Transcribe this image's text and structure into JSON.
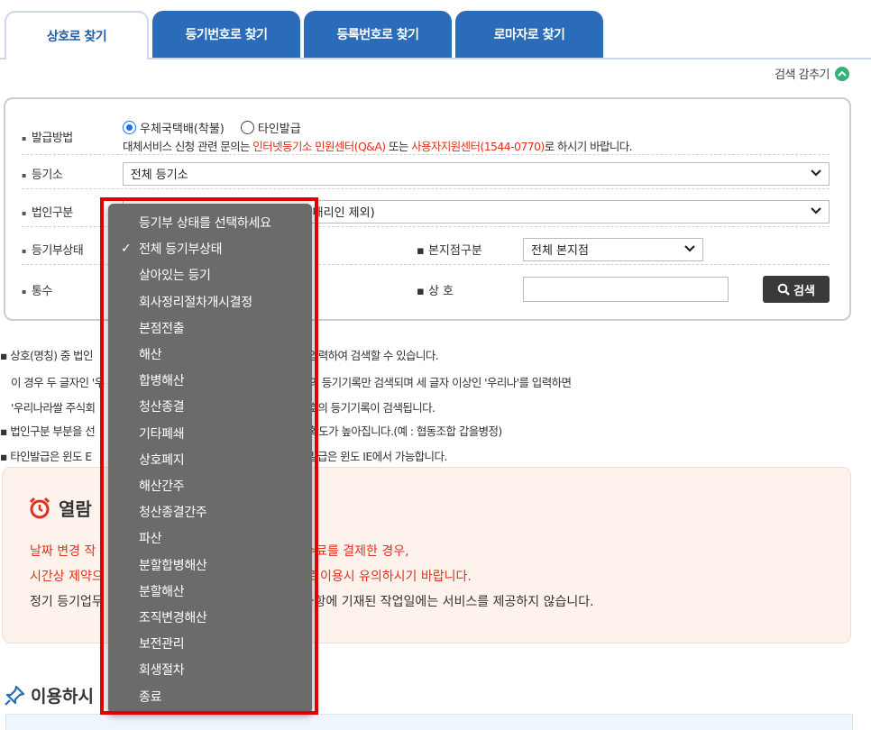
{
  "tabs": [
    {
      "label": "상호로 찾기",
      "active": true
    },
    {
      "label": "등기번호로 찾기",
      "active": false
    },
    {
      "label": "등록번호로 찾기",
      "active": false
    },
    {
      "label": "로마자로 찾기",
      "active": false
    }
  ],
  "toggle_label": "검색 감추기",
  "form": {
    "issue_method": {
      "label": "발급방법",
      "option1": "우체국택배(착불)",
      "option2": "타인발급",
      "notice_prefix": "대체서비스 신청 관련 문의는 ",
      "notice_link1": "인터넷등기소 민원센터(Q&A)",
      "notice_mid": " 또는 ",
      "notice_link2": "사용자지원센터(1544-0770)",
      "notice_suffix": "로 하시기 바랍니다."
    },
    "registry": {
      "label": "등기소",
      "value": "전체 등기소"
    },
    "corp_type": {
      "label": "법인구분",
      "value_tail": "대리인 제외)"
    },
    "status": {
      "label": "등기부상태"
    },
    "branch": {
      "label": "본지점구분",
      "value": "전체 본지점"
    },
    "copies": {
      "label": "통수"
    },
    "name": {
      "label": "상 호"
    },
    "search_button": "검색"
  },
  "notes": {
    "n1a": "상호(명칭) 중 법인",
    "n1b": "입력란에 입력하여 검색할 수 있습니다.",
    "n2a": "이 경우 두 글자인 '우",
    "n2b": "일한 상호의 등기기록만 검색되며 세 글자 이상인 '우리나'를 입력하면",
    "n3a": "'우리나라쌀 주식회",
    "n3b": "하는 상호의 등기기록이 검색됩니다.",
    "n4a": "법인구분 부분을 선",
    "n4b": "의 정확도가 높아집니다.(예 : 협동조합 갑을병정)",
    "n5a": "타인발급은 윈도 E",
    "n5b": "능하며, 발급은 윈도 IE에서 가능합니다."
  },
  "notice": {
    "title": "열람",
    "l1a": "날짜 변경 작",
    "l1b": "수수료를 결제한 경우,",
    "l2a": "시간상 제약으",
    "l2b": "므로 이용시 유의하시기 바랍니다.",
    "l3a": "정기 등기업무",
    "l3b": "지사항에 기재된 작업일에는 서비스를 제공하지 않습니다."
  },
  "usage_title": "이용하시",
  "dropdown": {
    "items": [
      "등기부 상태를 선택하세요",
      "전체 등기부상태",
      "살아있는 등기",
      "회사정리절차개시결정",
      "본점전출",
      "해산",
      "합병해산",
      "청산종결",
      "기타폐쇄",
      "상호폐지",
      "해산간주",
      "청산종결간주",
      "파산",
      "분할합병해산",
      "분할해산",
      "조직변경해산",
      "보전관리",
      "회생절차",
      "종료"
    ],
    "selected_index": 1
  },
  "colors": {
    "tab_blue": "#2b6cb8",
    "accent_red": "#e0301e",
    "highlight": "#e00000"
  }
}
